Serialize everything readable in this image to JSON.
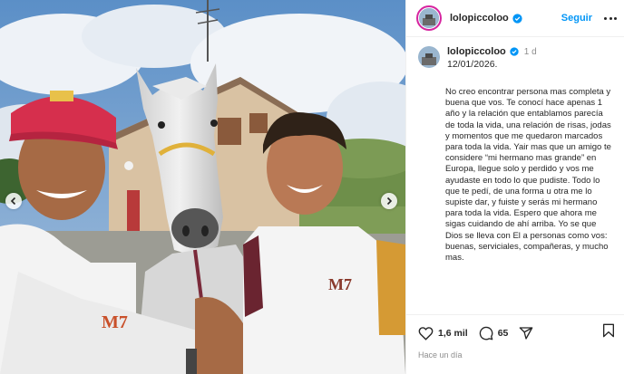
{
  "post": {
    "username": "lolopiccoloo",
    "follow_label": "Seguir",
    "caption": {
      "username": "lolopiccoloo",
      "time_ago": "1 d",
      "date": "12/01/2026.",
      "text": "No creo encontrar persona mas completa y buena que vos. Te conocí hace apenas 1 año y la relación que entablamos parecía de toda la vida, una relación de risas, jodas y momentos que me quedaron marcados para toda la vida. Yair mas que un amigo te considere “mi hermano mas grande” en Europa, llegue solo y perdido y vos me ayudaste en todo lo que pudiste. Todo lo que te pedí, de una forma u otra me lo supiste dar, y fuiste y serás mi hermano para toda la vida. Espero que ahora me sigas cuidando de ahí arriba. Yo se que Dios se lleva con El a personas como vos: buenas, serviciales, compañeras, y mucho mas."
    },
    "likes": "1,6 mil",
    "comments": "65",
    "timestamp": "Hace un día",
    "shirt_logo": "M7"
  },
  "colors": {
    "follow": "#0095f6",
    "verified": "#0095f6",
    "story_ring": "#d6249f"
  },
  "icons": [
    "verified-icon",
    "more-options-icon",
    "heart-icon",
    "comment-icon",
    "share-icon",
    "bookmark-icon",
    "chevron-left-icon",
    "chevron-right-icon"
  ]
}
